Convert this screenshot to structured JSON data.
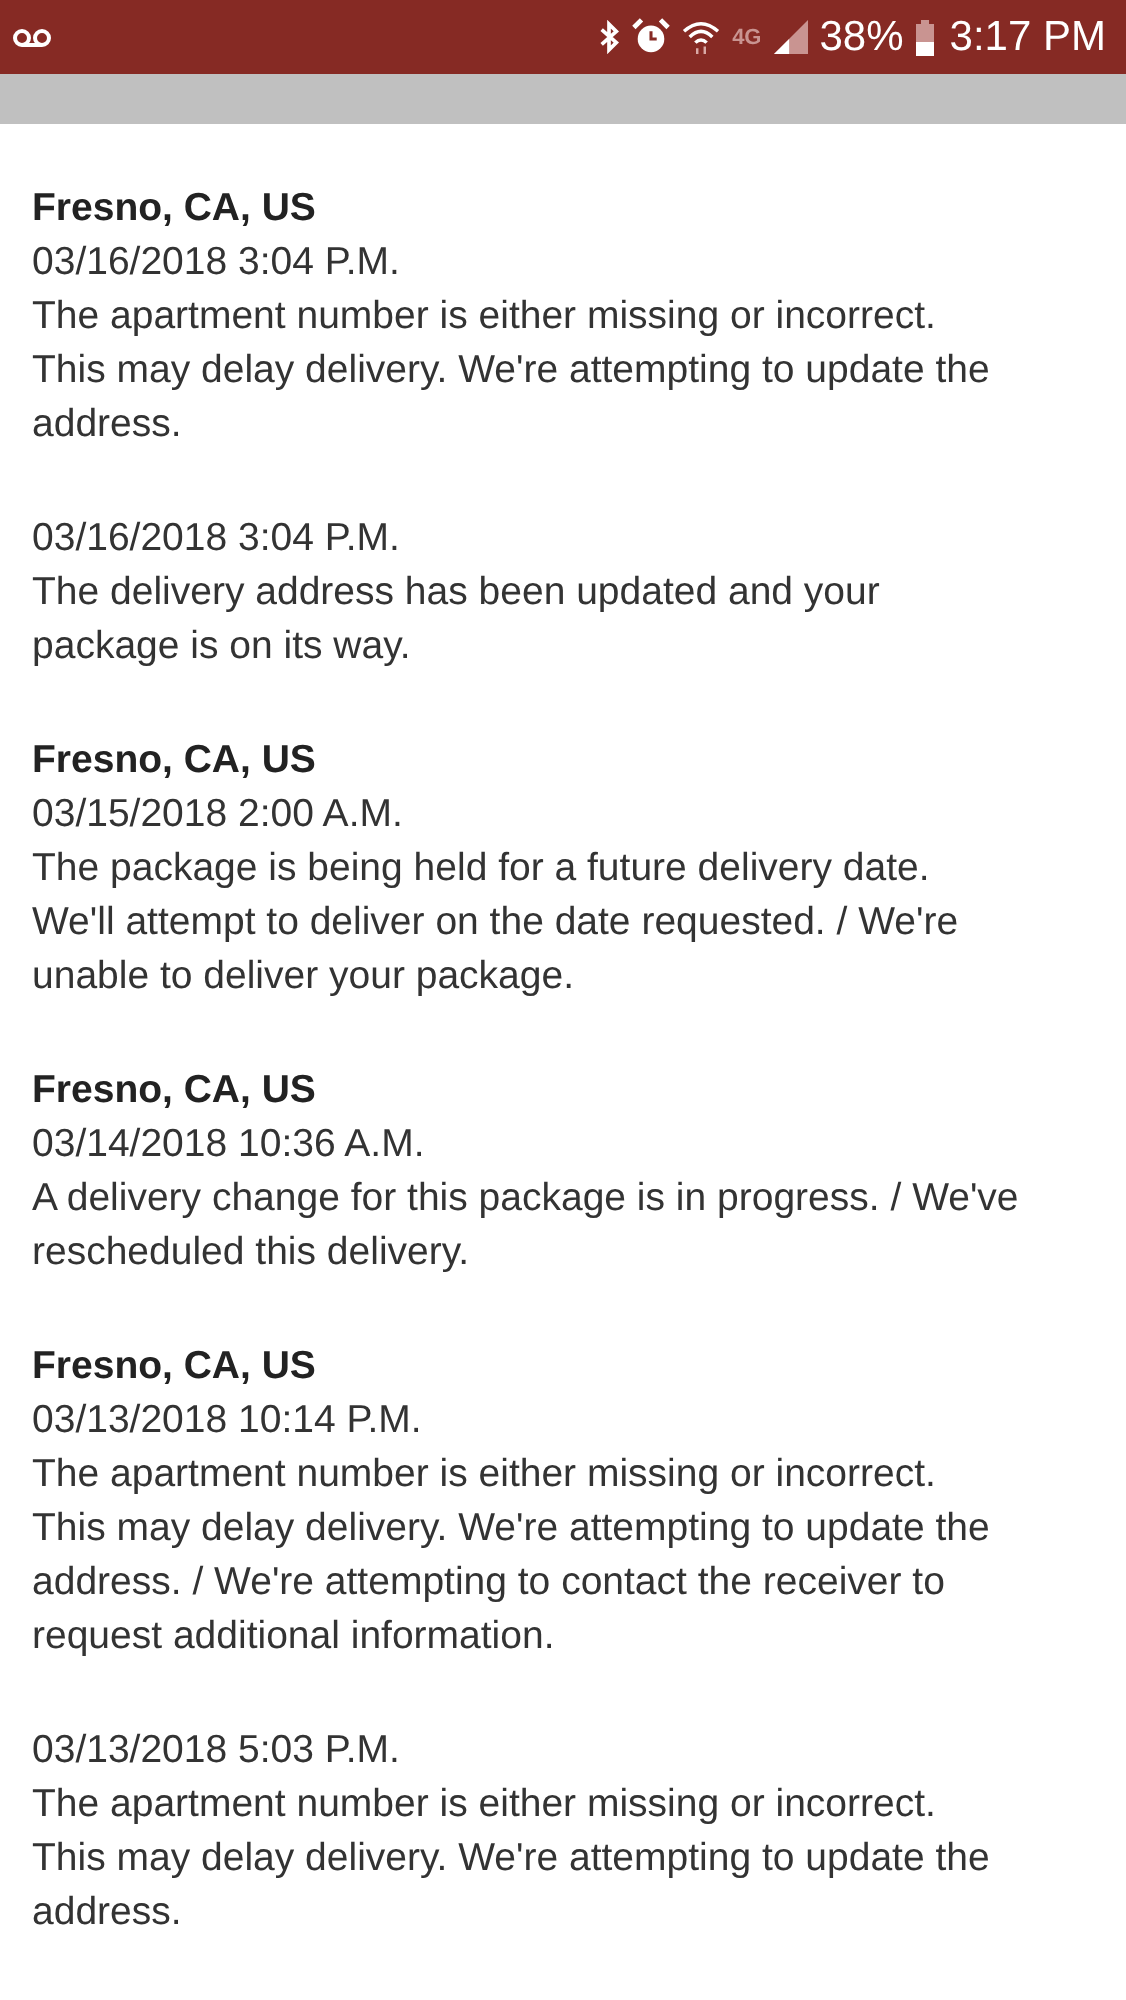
{
  "status_bar": {
    "network": "4G",
    "battery": "38%",
    "time": "3:17 PM"
  },
  "events": [
    {
      "location": "Fresno, CA, US",
      "datetime": "03/16/2018 3:04 P.M.",
      "description": [
        "The apartment number is either missing or incorrect.",
        "This may delay delivery. We're attempting to update the",
        "address."
      ]
    },
    {
      "datetime": "03/16/2018 3:04 P.M.",
      "description": [
        "The delivery address has been updated and your",
        "package is on its way."
      ]
    },
    {
      "location": "Fresno, CA, US",
      "datetime": "03/15/2018 2:00 A.M.",
      "description": [
        "The package is being held for a future delivery date.",
        "We'll attempt to deliver on the date requested. / We're",
        "unable to deliver your package."
      ]
    },
    {
      "location": "Fresno, CA, US",
      "datetime": "03/14/2018 10:36 A.M.",
      "description": [
        "A delivery change for this package is in progress. / We've",
        "rescheduled this delivery."
      ]
    },
    {
      "location": "Fresno, CA, US",
      "datetime": "03/13/2018 10:14 P.M.",
      "description": [
        "The apartment number is either missing or incorrect.",
        "This may delay delivery. We're attempting to update the",
        "address. / We're attempting to contact the receiver to",
        "request additional information."
      ]
    },
    {
      "datetime": "03/13/2018 5:03 P.M.",
      "description": [
        "The apartment number is either missing or incorrect.",
        "This may delay delivery. We're attempting to update the",
        "address."
      ]
    }
  ]
}
